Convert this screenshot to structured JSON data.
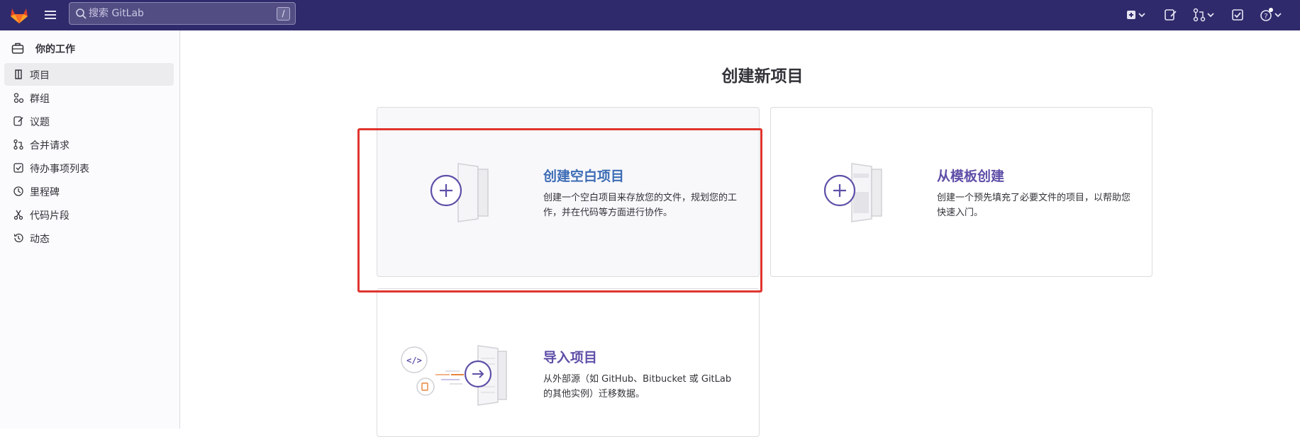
{
  "topbar": {
    "search": {
      "placeholder": "搜索 GitLab",
      "shortcut": "/"
    },
    "icons": [
      "gitlab-logo",
      "hamburger-icon",
      "plus-square-icon",
      "issues-icon",
      "merge-request-icon",
      "todo-icon",
      "help-icon"
    ]
  },
  "sidebar": {
    "header": "你的工作",
    "items": [
      {
        "label": "项目",
        "icon": "project-icon",
        "active": true
      },
      {
        "label": "群组",
        "icon": "group-icon",
        "active": false
      },
      {
        "label": "议题",
        "icon": "issues-icon",
        "active": false
      },
      {
        "label": "合并请求",
        "icon": "merge-request-icon",
        "active": false
      },
      {
        "label": "待办事项列表",
        "icon": "todo-icon",
        "active": false
      },
      {
        "label": "里程碑",
        "icon": "clock-icon",
        "active": false
      },
      {
        "label": "代码片段",
        "icon": "scissors-icon",
        "active": false
      },
      {
        "label": "动态",
        "icon": "history-icon",
        "active": false
      }
    ]
  },
  "main": {
    "title": "创建新项目",
    "cards": [
      {
        "title": "创建空白项目",
        "desc_line1": "创建一个空白项目来存放您的文件，规划您的工",
        "desc_line2": "作，并在代码等方面进行协作。"
      },
      {
        "title": "从模板创建",
        "desc_line1": "创建一个预先填充了必要文件的项目，以帮助您",
        "desc_line2": "快速入门。"
      },
      {
        "title": "导入项目",
        "desc_line1": "从外部源（如 GitHub、Bitbucket 或 GitLab",
        "desc_line2": "的其他实例）迁移数据。"
      }
    ]
  },
  "colors": {
    "topbar": "#2f2a6b",
    "accent": "#5f4fa8",
    "highlight": "#e0342e",
    "sidebar_active": "#ececef"
  }
}
